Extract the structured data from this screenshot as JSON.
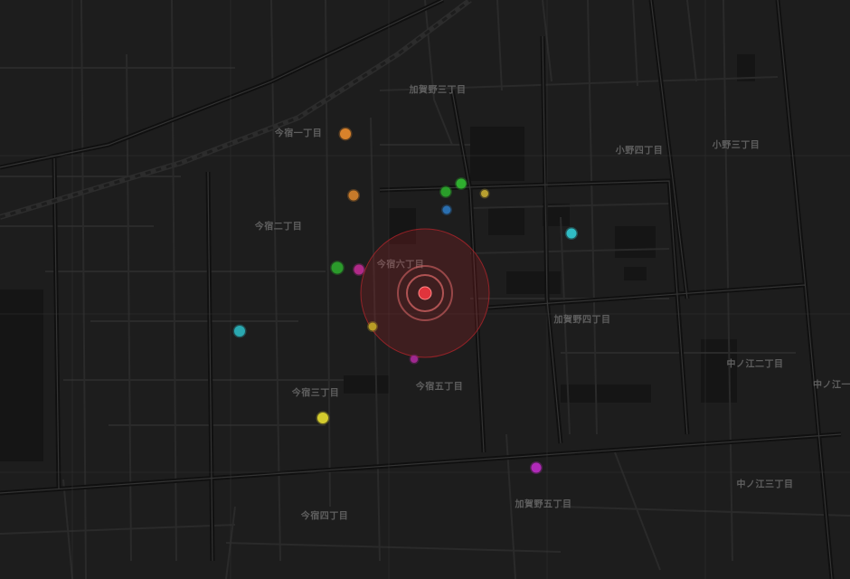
{
  "map": {
    "district_labels": [
      {
        "id": "kagano-3",
        "text": "加賀野三丁目"
      },
      {
        "id": "imajuku-1",
        "text": "今宿一丁目"
      },
      {
        "id": "ono-4",
        "text": "小野四丁目"
      },
      {
        "id": "ono-3",
        "text": "小野三丁目"
      },
      {
        "id": "imajuku-2",
        "text": "今宿二丁目"
      },
      {
        "id": "imajuku-6",
        "text": "今宿六丁目"
      },
      {
        "id": "kagano-4",
        "text": "加賀野四丁目"
      },
      {
        "id": "nakanoe-2",
        "text": "中ノ江二丁目"
      },
      {
        "id": "nakanoe-1",
        "text": "中ノ江一"
      },
      {
        "id": "imajuku-3",
        "text": "今宿三丁目"
      },
      {
        "id": "imajuku-5",
        "text": "今宿五丁目"
      },
      {
        "id": "nakanoe-3",
        "text": "中ノ江三丁目"
      },
      {
        "id": "kagano-5",
        "text": "加賀野五丁目"
      },
      {
        "id": "imajuku-4",
        "text": "今宿四丁目"
      }
    ],
    "focus_marker": {
      "color": "#e0343c",
      "halo_color": "#d8262e"
    },
    "poi_markers": [
      {
        "id": "poi-orange-1",
        "color": "#d9822b"
      },
      {
        "id": "poi-orange-2",
        "color": "#c67a2a"
      },
      {
        "id": "poi-green-1",
        "color": "#2fae2f"
      },
      {
        "id": "poi-green-2",
        "color": "#2a9e2a"
      },
      {
        "id": "poi-green-3",
        "color": "#2b9a2b"
      },
      {
        "id": "poi-yellow-1",
        "color": "#b8a030"
      },
      {
        "id": "poi-yellow-2",
        "color": "#b89c26"
      },
      {
        "id": "poi-yellow-3",
        "color": "#d4cc2e"
      },
      {
        "id": "poi-blue-1",
        "color": "#2a6fb0"
      },
      {
        "id": "poi-cyan-1",
        "color": "#30bcc4"
      },
      {
        "id": "poi-cyan-2",
        "color": "#2aa8b0"
      },
      {
        "id": "poi-magenta-1",
        "color": "#b02a88"
      },
      {
        "id": "poi-magenta-2",
        "color": "#a02890"
      },
      {
        "id": "poi-magenta-3",
        "color": "#b02ab8"
      }
    ]
  }
}
